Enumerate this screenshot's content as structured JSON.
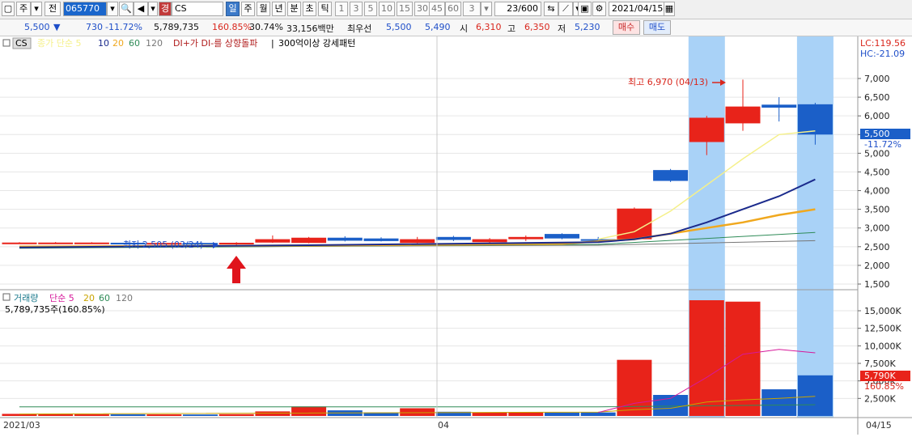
{
  "toolbar": {
    "market": "주",
    "mode": "전",
    "code": "065770",
    "grade": "경",
    "name": "CS",
    "periods": [
      "일",
      "주",
      "월",
      "년",
      "분",
      "초",
      "틱"
    ],
    "intervals": [
      "1",
      "3",
      "5",
      "10",
      "15",
      "30",
      "45",
      "60"
    ],
    "interval_value": "3",
    "count": "23/600",
    "date": "2021/04/15"
  },
  "quote": {
    "price": "5,500",
    "change": "730",
    "change_rate": "-11.72%",
    "volume": "5,789,735",
    "vol_ratio": "160.85%",
    "turnover": "30.74%",
    "amount": "33,156백만",
    "best_label": "최우선",
    "best_ask": "5,500",
    "best_bid": "5,490",
    "open_label": "시",
    "open": "6,310",
    "high_label": "고",
    "high": "6,350",
    "low_label": "저",
    "low": "5,230",
    "buy_label": "매수",
    "sell_label": "매도"
  },
  "legend": {
    "tag": "CS",
    "ma_label": "종가 단순 5",
    "ma10": "10",
    "ma20": "20",
    "ma60": "60",
    "ma120": "120",
    "signal1": "DI+가 DI-를 상향돌파",
    "signal2": "300억이상 강세패턴",
    "vol_label": "거래량",
    "vol_ma": "단순 5",
    "vol_ma20": "20",
    "vol_ma60": "60",
    "vol_ma120": "120",
    "vol_value": "5,789,735주(160.85%)"
  },
  "right_info": {
    "lc": "LC:119.56",
    "hc": "HC:-21.09",
    "cur_price": "5,500",
    "cur_rate": "-11.72%",
    "cur_vol": "5,790K",
    "cur_vol_rate": "160.85%"
  },
  "annotations": {
    "high": "최고 6,970 (04/13)",
    "low": "최저 2,505 (03/24)"
  },
  "chart_data": {
    "type": "candlestick",
    "price_ticks": [
      "7,000",
      "6,500",
      "6,000",
      "5,500",
      "5,000",
      "4,500",
      "4,000",
      "3,500",
      "3,000",
      "2,500",
      "2,000",
      "1,500"
    ],
    "price_tick_values": [
      7000,
      6500,
      6000,
      5500,
      5000,
      4500,
      4000,
      3500,
      3000,
      2500,
      2000,
      1500
    ],
    "volume_ticks": [
      "15,000K",
      "12,500K",
      "10,000K",
      "7,500K",
      "5,000K",
      "2,500K"
    ],
    "volume_tick_values": [
      15000,
      12500,
      10000,
      7500,
      5000,
      2500
    ],
    "x_labels": [
      "2021/03",
      "04",
      "04/15"
    ],
    "colors": {
      "up": "#e8231a",
      "down": "#1b5fc8",
      "ma5": "#f5f08a",
      "ma10": "#1a2a8c",
      "ma20": "#f0a81e",
      "ma60": "#2e8b57",
      "ma120": "#777777",
      "vol_ma5": "#d6199a",
      "highlight": "#a9d2f7"
    },
    "candles": [
      {
        "o": 2600,
        "h": 2620,
        "l": 2590,
        "c": 2610,
        "v": 300
      },
      {
        "o": 2600,
        "h": 2625,
        "l": 2585,
        "c": 2610,
        "v": 260
      },
      {
        "o": 2600,
        "h": 2620,
        "l": 2585,
        "c": 2610,
        "v": 250
      },
      {
        "o": 2605,
        "h": 2620,
        "l": 2580,
        "c": 2590,
        "v": 240
      },
      {
        "o": 2590,
        "h": 2610,
        "l": 2570,
        "c": 2600,
        "v": 230
      },
      {
        "o": 2600,
        "h": 2615,
        "l": 2580,
        "c": 2595,
        "v": 210
      },
      {
        "o": 2575,
        "h": 2620,
        "l": 2505,
        "c": 2605,
        "v": 260
      },
      {
        "o": 2610,
        "h": 2800,
        "l": 2600,
        "c": 2700,
        "v": 650
      },
      {
        "o": 2600,
        "h": 2760,
        "l": 2590,
        "c": 2740,
        "v": 1350
      },
      {
        "o": 2740,
        "h": 2780,
        "l": 2640,
        "c": 2660,
        "v": 800
      },
      {
        "o": 2720,
        "h": 2750,
        "l": 2640,
        "c": 2650,
        "v": 500
      },
      {
        "o": 2600,
        "h": 2760,
        "l": 2590,
        "c": 2700,
        "v": 1100
      },
      {
        "o": 2760,
        "h": 2790,
        "l": 2650,
        "c": 2680,
        "v": 600
      },
      {
        "o": 2620,
        "h": 2730,
        "l": 2600,
        "c": 2700,
        "v": 500
      },
      {
        "o": 2700,
        "h": 2800,
        "l": 2650,
        "c": 2760,
        "v": 520
      },
      {
        "o": 2840,
        "h": 2860,
        "l": 2700,
        "c": 2720,
        "v": 480
      },
      {
        "o": 2700,
        "h": 2760,
        "l": 2650,
        "c": 2680,
        "v": 500
      },
      {
        "o": 2700,
        "h": 3550,
        "l": 2680,
        "c": 3520,
        "v": 8000
      },
      {
        "o": 4550,
        "h": 4580,
        "l": 4230,
        "c": 4260,
        "v": 3000
      },
      {
        "o": 5300,
        "h": 6000,
        "l": 4950,
        "c": 5950,
        "v": 16500
      },
      {
        "o": 5800,
        "h": 6970,
        "l": 5600,
        "c": 6250,
        "v": 16300
      },
      {
        "o": 6300,
        "h": 6500,
        "l": 5850,
        "c": 6220,
        "v": 3800
      },
      {
        "o": 6310,
        "h": 6350,
        "l": 5230,
        "c": 5500,
        "v": 5790
      }
    ],
    "highlight_candles": [
      19,
      23
    ],
    "ma5": [
      [
        16,
        2700
      ],
      [
        17,
        2900
      ],
      [
        18,
        3450
      ],
      [
        19,
        4150
      ],
      [
        20,
        4850
      ],
      [
        21,
        5500
      ],
      [
        22,
        5600
      ]
    ],
    "ma10": [
      [
        0,
        2480
      ],
      [
        8,
        2540
      ],
      [
        16,
        2620
      ],
      [
        17,
        2700
      ],
      [
        18,
        2850
      ],
      [
        19,
        3150
      ],
      [
        20,
        3500
      ],
      [
        21,
        3850
      ],
      [
        22,
        4300
      ]
    ],
    "ma20": [
      [
        0,
        2500
      ],
      [
        8,
        2530
      ],
      [
        15,
        2580
      ],
      [
        17,
        2700
      ],
      [
        18,
        2850
      ],
      [
        19,
        3000
      ],
      [
        20,
        3150
      ],
      [
        21,
        3350
      ],
      [
        22,
        3500
      ]
    ],
    "ma60": [
      [
        0,
        2460
      ],
      [
        16,
        2560
      ],
      [
        22,
        2880
      ]
    ],
    "ma120": [
      [
        0,
        2480
      ],
      [
        16,
        2540
      ],
      [
        22,
        2660
      ]
    ],
    "vol_ma5": [
      [
        16,
        500
      ],
      [
        17,
        1800
      ],
      [
        18,
        2500
      ],
      [
        19,
        5500
      ],
      [
        20,
        8800
      ],
      [
        21,
        9500
      ],
      [
        22,
        9000
      ]
    ],
    "vol_ma20": [
      [
        0,
        280
      ],
      [
        16,
        550
      ],
      [
        17,
        900
      ],
      [
        18,
        1100
      ],
      [
        19,
        2000
      ],
      [
        20,
        2300
      ],
      [
        21,
        2500
      ],
      [
        22,
        2800
      ]
    ],
    "vol_ma60": [
      [
        0,
        1300
      ],
      [
        16,
        1300
      ],
      [
        22,
        1600
      ]
    ]
  }
}
